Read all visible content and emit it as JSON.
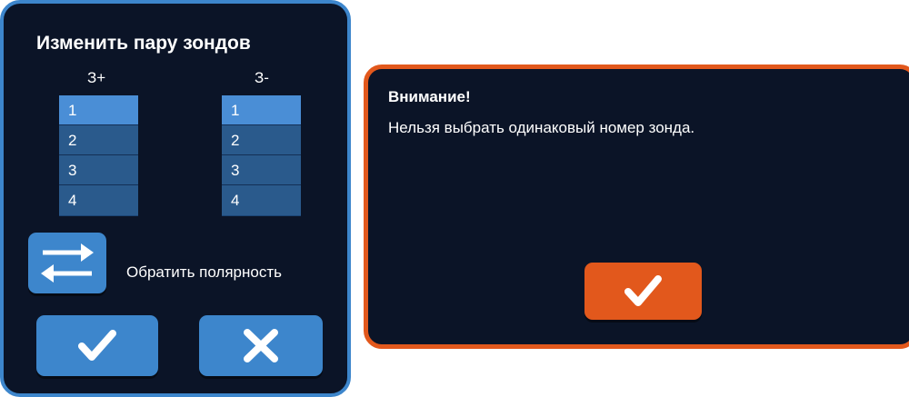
{
  "probe_dialog": {
    "title": "Изменить пару зондов",
    "positive_header": "З+",
    "negative_header": "З-",
    "positive_list": [
      "1",
      "2",
      "3",
      "4"
    ],
    "negative_list": [
      "1",
      "2",
      "3",
      "4"
    ],
    "selected_positive": "1",
    "selected_negative": "1",
    "reverse_polarity_label": "Обратить полярность",
    "reverse_icon": "swap-arrows-icon",
    "confirm_icon": "checkmark-icon",
    "cancel_icon": "close-icon"
  },
  "warning_dialog": {
    "title": "Внимание!",
    "message": "Нельзя выбрать одинаковый номер зонда.",
    "ok_icon": "checkmark-icon"
  },
  "colors": {
    "panel_background": "#0b1427",
    "accent_blue": "#3d86cc",
    "accent_orange": "#e2581c",
    "list_item": "#2a5a8c",
    "list_selected": "#4a8ed6"
  }
}
